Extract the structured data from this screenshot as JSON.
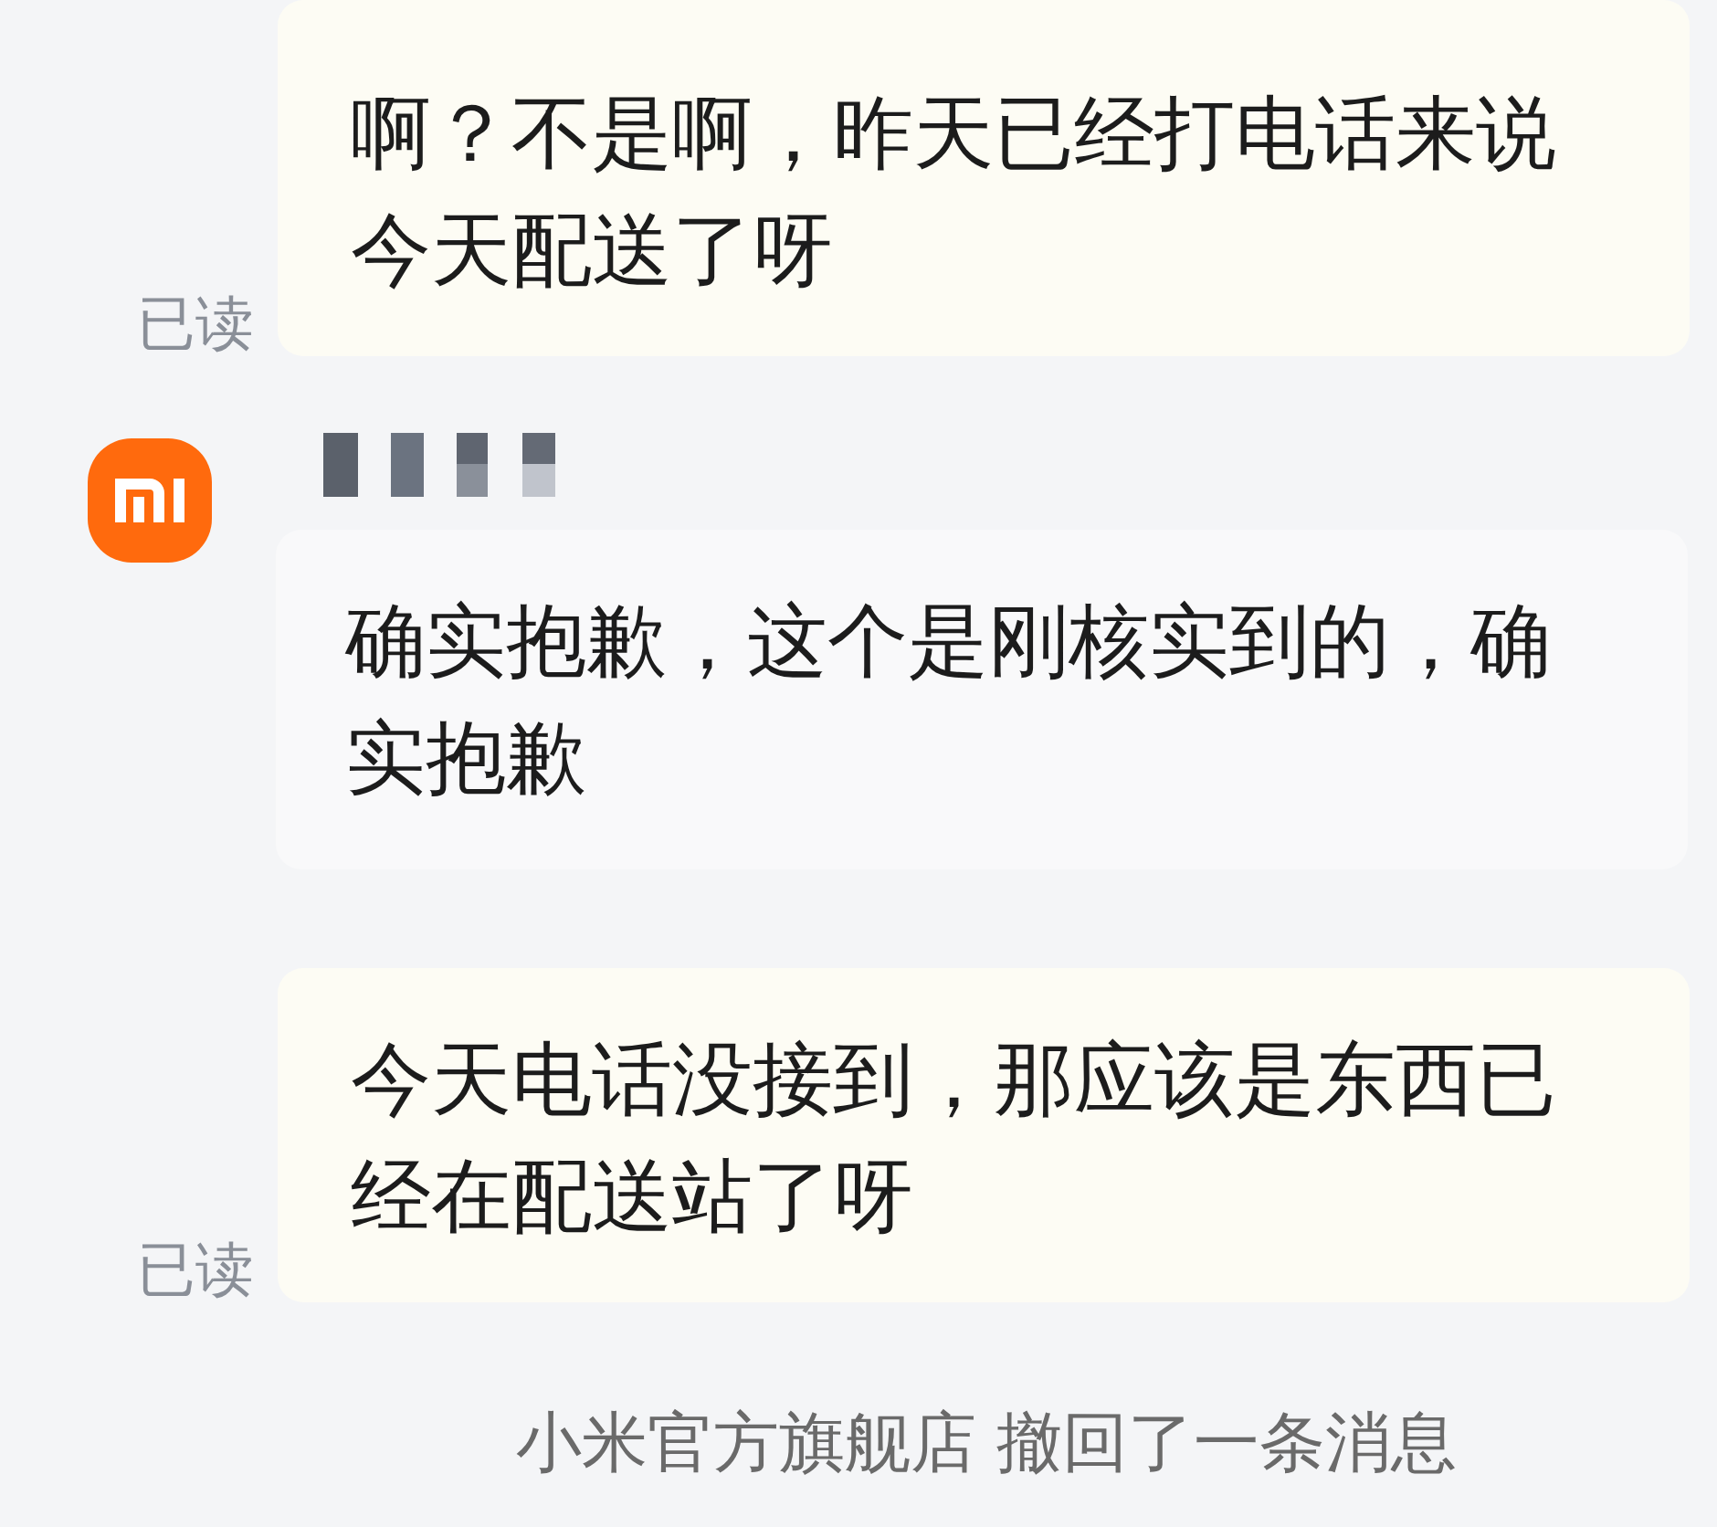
{
  "messages": [
    {
      "kind": "outgoing",
      "text": "啊？不是啊，昨天已经打电话来说今天配送了呀",
      "read_label": "已读"
    },
    {
      "kind": "incoming",
      "text": "确实抱歉，这个是刚核实到的，确实抱歉"
    },
    {
      "kind": "outgoing",
      "text": "今天电话没接到，那应该是东西已经在配送站了呀",
      "read_label": "已读"
    }
  ],
  "system_notice": "小米官方旗舰店 撤回了一条消息"
}
